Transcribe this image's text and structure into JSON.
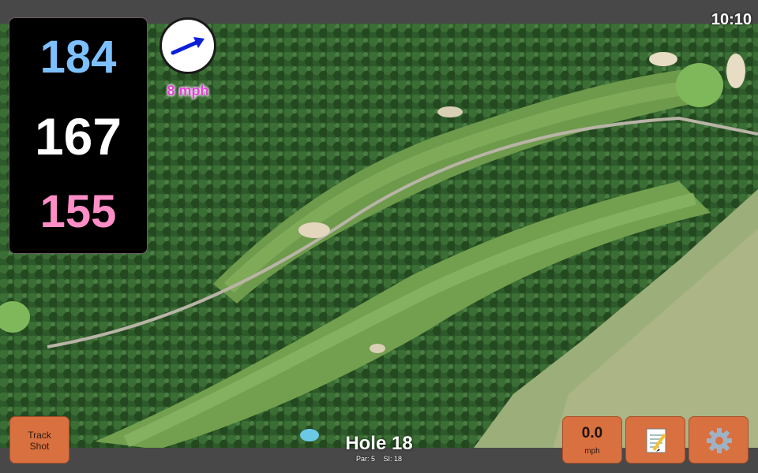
{
  "status_bar": {
    "time": "10:10"
  },
  "distances": {
    "back": "184",
    "middle": "167",
    "front": "155"
  },
  "wind": {
    "speed_label": "8 mph",
    "arrow_icon": "arrow-right-icon"
  },
  "hole": {
    "title": "Hole 18",
    "par_label": "Par: 5",
    "si_label": "SI: 18"
  },
  "buttons": {
    "track_shot": {
      "line1": "Track",
      "line2": "Shot"
    },
    "speed": {
      "value": "0.0",
      "unit": "mph"
    },
    "notes": {
      "icon": "notepad-icon"
    },
    "settings": {
      "icon": "gear-icon"
    }
  },
  "colors": {
    "back_distance": "#7cc0ff",
    "middle_distance": "#ffffff",
    "front_distance": "#ff8dc6",
    "button_orange": "#d9703f",
    "wind_text": "#e540d9",
    "wind_arrow": "#0a1fd8"
  }
}
